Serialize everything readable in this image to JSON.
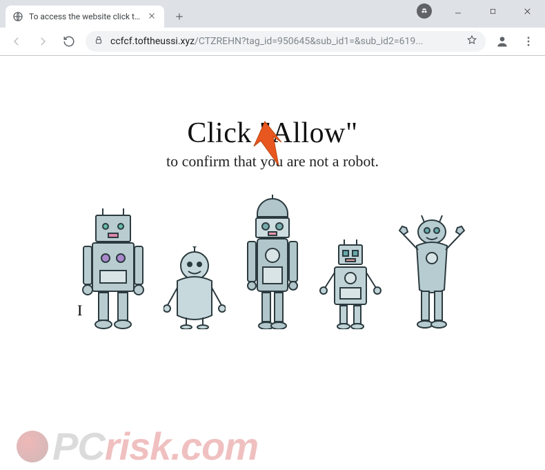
{
  "window": {
    "tab_title": "To access the website click the \"A",
    "url_host": "ccfcf.toftheussi.xyz",
    "url_path": "/CTZREHN?tag_id=950645&sub_id1=&sub_id2=619..."
  },
  "page": {
    "heading": "Click \"Allow\"",
    "subheading": "to confirm that you are not a robot."
  },
  "watermark": {
    "text_prefix": "PC",
    "text_suffix": "risk.com"
  }
}
